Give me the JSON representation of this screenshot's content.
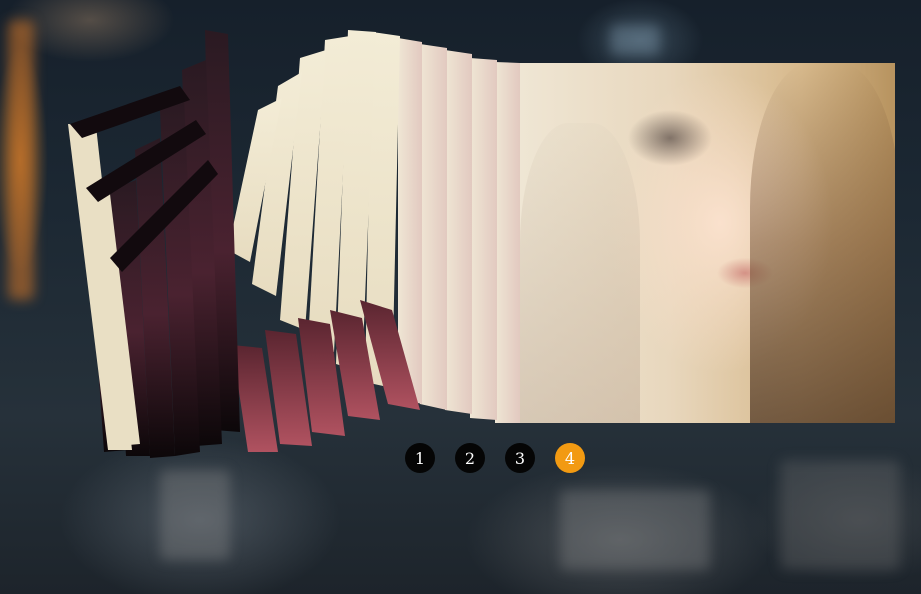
{
  "slider": {
    "pagination": [
      {
        "label": "1",
        "active": false
      },
      {
        "label": "2",
        "active": false
      },
      {
        "label": "3",
        "active": false
      },
      {
        "label": "4",
        "active": true
      }
    ],
    "active_color": "#f29a12",
    "dot_color": "#050505"
  }
}
